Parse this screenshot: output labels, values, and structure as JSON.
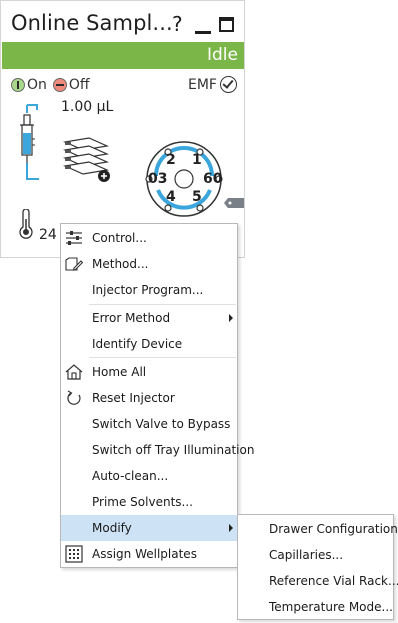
{
  "panel": {
    "title": "Online Sampl...",
    "help_label": "?",
    "status": "Idle",
    "status_color": "#7ab648",
    "power_on_label": "On",
    "power_off_label": "Off",
    "emf_label": "EMF",
    "volume": "1.00 µL",
    "temperature": "24",
    "valve_ports": [
      "1",
      "2",
      "3",
      "4",
      "5",
      "6"
    ],
    "valve_accent": "#3aa6dc",
    "valve_port_labels": {
      "top_left": "2",
      "top_right": "1",
      "left": "03",
      "right": "60",
      "bottom_left": "4",
      "bottom_right": "5"
    }
  },
  "menu": {
    "items": [
      {
        "label": "Control...",
        "icon": "sliders-icon"
      },
      {
        "label": "Method...",
        "icon": "method-edit-icon"
      },
      {
        "label": "Injector Program...",
        "icon": ""
      },
      {
        "label": "Error Method",
        "icon": "",
        "submenu": true
      },
      {
        "label": "Identify Device",
        "icon": ""
      },
      {
        "label": "Home All",
        "icon": "home-icon"
      },
      {
        "label": "Reset Injector",
        "icon": "reset-arrow-icon"
      },
      {
        "label": "Switch Valve to Bypass",
        "icon": ""
      },
      {
        "label": "Switch off Tray Illumination",
        "icon": ""
      },
      {
        "label": "Auto-clean...",
        "icon": ""
      },
      {
        "label": "Prime Solvents...",
        "icon": ""
      },
      {
        "label": "Modify",
        "icon": "",
        "submenu": true,
        "highlighted": true
      },
      {
        "label": "Assign Wellplates",
        "icon": "wellplate-grid-icon"
      }
    ],
    "highlight_color": "#cde3f5"
  },
  "submenu": {
    "items": [
      {
        "label": "Drawer Configuration..."
      },
      {
        "label": "Capillaries..."
      },
      {
        "label": "Reference Vial Rack..."
      },
      {
        "label": "Temperature Mode..."
      }
    ]
  }
}
